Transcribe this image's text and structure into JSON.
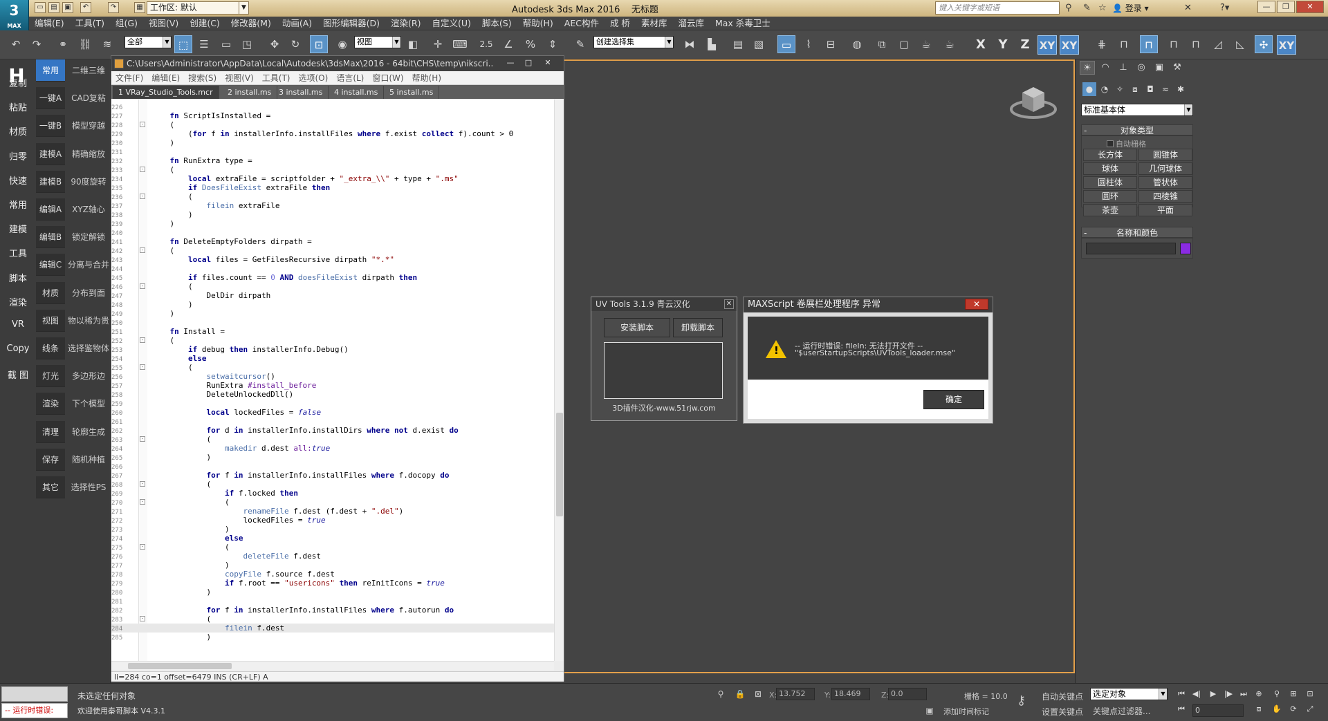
{
  "app": {
    "logo": "MAX",
    "workspace": "工作区: 默认",
    "title": "Autodesk 3ds Max 2016",
    "doc": "无标题",
    "search_placeholder": "键入关键字或短语",
    "login": "登录"
  },
  "menubar": [
    "编辑(E)",
    "工具(T)",
    "组(G)",
    "视图(V)",
    "创建(C)",
    "修改器(M)",
    "动画(A)",
    "图形编辑器(D)",
    "渲染(R)",
    "自定义(U)",
    "脚本(S)",
    "帮助(H)",
    "AEC构件",
    "成 桥",
    "素材库",
    "溜云库",
    "Max 杀毒卫士"
  ],
  "toolbar": {
    "filter": "全部",
    "view": "视图",
    "selset": "创建选择集",
    "snap_value": "2.5",
    "axes": [
      "X",
      "Y",
      "Z",
      "XY",
      "XY"
    ]
  },
  "leftpanel": {
    "col1": [
      "复制",
      "粘贴",
      "材质",
      "归零",
      "快速",
      "常用",
      "建模",
      "工具",
      "脚本",
      "渲染",
      "VR",
      "Copy",
      "截 图"
    ],
    "col2": [
      "常用",
      "一键A",
      "一键B",
      "建模A",
      "建模B",
      "编辑A",
      "编辑B",
      "编辑C",
      "材质",
      "视图",
      "线条",
      "灯光",
      "渲染",
      "清理",
      "保存",
      "其它"
    ],
    "col3": [
      "二维三维",
      "CAD复粘",
      "模型穿越",
      "精确缩放",
      "90度旋转",
      "XYZ轴心",
      "锁定解锁",
      "分离与合并",
      "分布到面",
      "物以稀为贵",
      "选择鉴物体",
      "多边形边",
      "下个模型",
      "轮廓生成",
      "随机种植",
      "选择性PS"
    ]
  },
  "editor": {
    "title_path": "C:\\Users\\Administrator\\AppData\\Local\\Autodesk\\3dsMax\\2016 - 64bit\\CHS\\temp\\nikscri...",
    "menu": [
      "文件(F)",
      "编辑(E)",
      "搜索(S)",
      "视图(V)",
      "工具(T)",
      "选项(O)",
      "语言(L)",
      "窗口(W)",
      "帮助(H)"
    ],
    "tabs": [
      "1 VRay_Studio_Tools.mcr",
      "2 install.ms",
      "3 install.ms",
      "4 install.ms",
      "5 install.ms"
    ],
    "status": "li=284 co=1 offset=6479 INS (CR+LF) A"
  },
  "uvtools": {
    "title": "UV Tools 3.1.9 青云汉化",
    "install": "安装脚本",
    "uninstall": "卸载脚本",
    "footer": "3D插件汉化-www.51rjw.com"
  },
  "error": {
    "title": "MAXScript 卷展栏处理程序 异常",
    "line1": "-- 运行时错误: fileIn: 无法打开文件 --",
    "line2": "\"$userStartupScripts\\UVTools_loader.mse\"",
    "ok": "确定"
  },
  "cmdpanel": {
    "primitive_type": "标准基本体",
    "object_type": "对象类型",
    "autogrid": "自动栅格",
    "buttons": [
      "长方体",
      "圆锥体",
      "球体",
      "几何球体",
      "圆柱体",
      "管状体",
      "圆环",
      "四棱锥",
      "茶壶",
      "平面"
    ],
    "name_color": "名称和颜色",
    "color": "#8a2be2"
  },
  "status": {
    "runtime_err": "-- 运行时错误:",
    "selection": "未选定任何对象",
    "welcome": "欢迎使用秦哥脚本 V4.3.1",
    "x_label": "X:",
    "x": "13.752",
    "y_label": "Y:",
    "y": "18.469",
    "z_label": "Z:",
    "z": "0.0",
    "grid": "栅格 = 10.0",
    "add_time_tag": "添加时间标记",
    "auto_key": "自动关键点",
    "set_key": "设置关键点",
    "sel_obj": "选定对象",
    "key_filters": "关键点过滤器...",
    "frame": "0"
  },
  "code": [
    {
      "n": "226",
      "t": ""
    },
    {
      "n": "227",
      "t": "    <span class='kw'>fn</span> ScriptIsInstalled ="
    },
    {
      "n": "228",
      "t": "    (",
      "f": "-"
    },
    {
      "n": "229",
      "t": "        (<span class='kw'>for</span> f <span class='kw'>in</span> installerInfo.installFiles <span class='kw'>where</span> f.exist <span class='kw'>collect</span> f).count &gt; 0"
    },
    {
      "n": "230",
      "t": "    )"
    },
    {
      "n": "231",
      "t": ""
    },
    {
      "n": "232",
      "t": "    <span class='kw'>fn</span> RunExtra type ="
    },
    {
      "n": "233",
      "t": "    (",
      "f": "-"
    },
    {
      "n": "234",
      "t": "        <span class='kw'>local</span> extraFile = scriptfolder + <span class='st'>\"_extra_\\\\\"</span> + type + <span class='st'>\".ms\"</span>"
    },
    {
      "n": "235",
      "t": "        <span class='kw'>if</span> <span class='bi'>DoesFileExist</span> extraFile <span class='kw'>then</span>"
    },
    {
      "n": "236",
      "t": "        (",
      "f": "-"
    },
    {
      "n": "237",
      "t": "            <span class='bi'>filein</span> extraFile"
    },
    {
      "n": "238",
      "t": "        )"
    },
    {
      "n": "239",
      "t": "    )"
    },
    {
      "n": "240",
      "t": ""
    },
    {
      "n": "241",
      "t": "    <span class='kw'>fn</span> DeleteEmptyFolders dirpath ="
    },
    {
      "n": "242",
      "t": "    (",
      "f": "-"
    },
    {
      "n": "243",
      "t": "        <span class='kw'>local</span> files = GetFilesRecursive dirpath <span class='st'>\"*.*\"</span>"
    },
    {
      "n": "244",
      "t": ""
    },
    {
      "n": "245",
      "t": "        <span class='kw'>if</span> files.count == <span class='nm'>0</span> <span class='kw'>AND</span> <span class='bi'>doesFileExist</span> dirpath <span class='kw'>then</span>"
    },
    {
      "n": "246",
      "t": "        (",
      "f": "-"
    },
    {
      "n": "247",
      "t": "            DelDir dirpath"
    },
    {
      "n": "248",
      "t": "        )"
    },
    {
      "n": "249",
      "t": "    )"
    },
    {
      "n": "250",
      "t": ""
    },
    {
      "n": "251",
      "t": "    <span class='kw'>fn</span> Install ="
    },
    {
      "n": "252",
      "t": "    (",
      "f": "-"
    },
    {
      "n": "253",
      "t": "        <span class='kw'>if</span> debug <span class='kw'>then</span> installerInfo.Debug()"
    },
    {
      "n": "254",
      "t": "        <span class='kw'>else</span>"
    },
    {
      "n": "255",
      "t": "        (",
      "f": "-"
    },
    {
      "n": "256",
      "t": "            <span class='bi'>setwaitcursor</span>()"
    },
    {
      "n": "257",
      "t": "            RunExtra <span class='nb'>#install_before</span>"
    },
    {
      "n": "258",
      "t": "            DeleteUnlockedDll()"
    },
    {
      "n": "259",
      "t": ""
    },
    {
      "n": "260",
      "t": "            <span class='kw'>local</span> lockedFiles = <span class='it'>false</span>"
    },
    {
      "n": "261",
      "t": ""
    },
    {
      "n": "262",
      "t": "            <span class='kw'>for</span> d <span class='kw'>in</span> installerInfo.installDirs <span class='kw'>where not</span> d.exist <span class='kw'>do</span>"
    },
    {
      "n": "263",
      "t": "            (",
      "f": "-"
    },
    {
      "n": "264",
      "t": "                <span class='bi'>makedir</span> d.dest <span class='nb'>all:</span><span class='it'>true</span>"
    },
    {
      "n": "265",
      "t": "            )"
    },
    {
      "n": "266",
      "t": ""
    },
    {
      "n": "267",
      "t": "            <span class='kw'>for</span> f <span class='kw'>in</span> installerInfo.installFiles <span class='kw'>where</span> f.docopy <span class='kw'>do</span>"
    },
    {
      "n": "268",
      "t": "            (",
      "f": "-"
    },
    {
      "n": "269",
      "t": "                <span class='kw'>if</span> f.locked <span class='kw'>then</span>"
    },
    {
      "n": "270",
      "t": "                (",
      "f": "-"
    },
    {
      "n": "271",
      "t": "                    <span class='bi'>renameFile</span> f.dest (f.dest + <span class='st'>\".del\"</span>)"
    },
    {
      "n": "272",
      "t": "                    lockedFiles = <span class='it'>true</span>"
    },
    {
      "n": "273",
      "t": "                )"
    },
    {
      "n": "274",
      "t": "                <span class='kw'>else</span>"
    },
    {
      "n": "275",
      "t": "                (",
      "f": "-"
    },
    {
      "n": "276",
      "t": "                    <span class='bi'>deleteFile</span> f.dest"
    },
    {
      "n": "277",
      "t": "                )"
    },
    {
      "n": "278",
      "t": "                <span class='bi'>copyFile</span> f.source f.dest"
    },
    {
      "n": "279",
      "t": "                <span class='kw'>if</span> f.root == <span class='st'>\"usericons\"</span> <span class='kw'>then</span> reInitIcons = <span class='it'>true</span>"
    },
    {
      "n": "280",
      "t": "            )"
    },
    {
      "n": "281",
      "t": ""
    },
    {
      "n": "282",
      "t": "            <span class='kw'>for</span> f <span class='kw'>in</span> installerInfo.installFiles <span class='kw'>where</span> f.autorun <span class='kw'>do</span>"
    },
    {
      "n": "283",
      "t": "            (",
      "f": "-"
    },
    {
      "n": "284",
      "t": "                <span class='bi'>filein</span> f.dest",
      "hl": true
    },
    {
      "n": "285",
      "t": "            )"
    }
  ]
}
